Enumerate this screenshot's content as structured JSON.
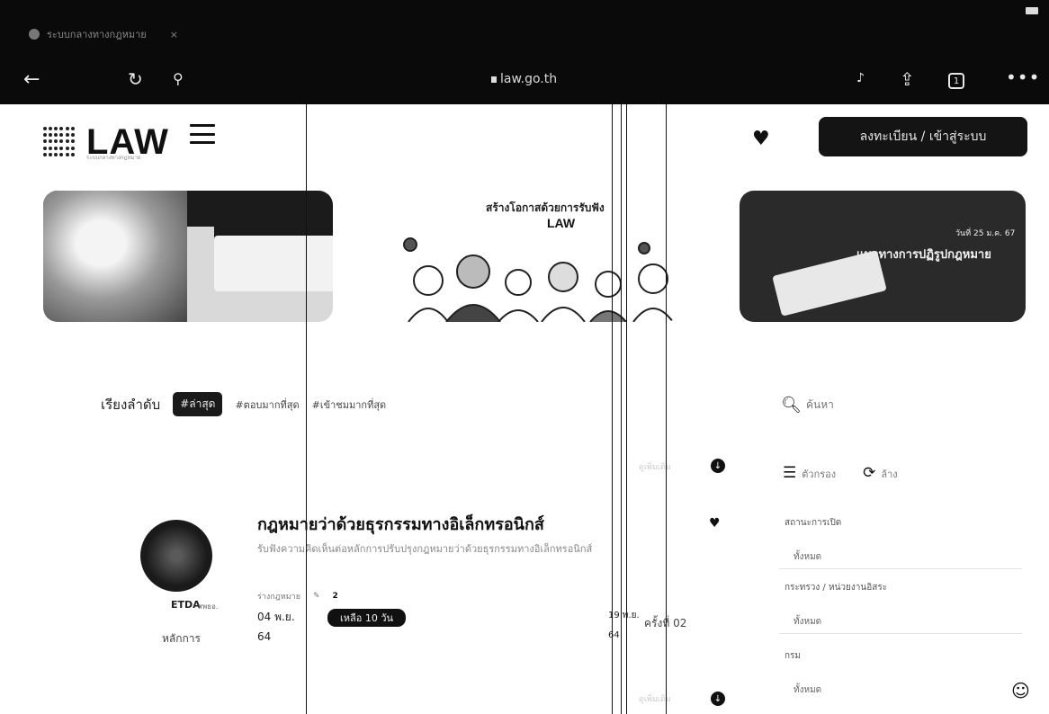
{
  "browser": {
    "tab_title": "ระบบกลางทางกฎหมาย",
    "tab_close": "×",
    "url": "law.go.th",
    "tab_count": "1",
    "icons": [
      "back-icon",
      "reload-icon",
      "translate-icon",
      "mic-icon",
      "share-icon",
      "tabs-icon",
      "more-icon"
    ]
  },
  "header": {
    "brand": "LAW",
    "tagline": "ระบบกลางทางกฎหมาย",
    "login_label": "ลงทะเบียน / เข้าสู่ระบบ"
  },
  "banners": [
    {
      "text": ""
    },
    {
      "title": "สร้างโอกาสด้วยการรับฟัง",
      "logo_text": "LAW"
    },
    {
      "badge": "วันที่ 25 ม.ค. 67",
      "title": "แนวทางการปฏิรูปกฎหมาย"
    }
  ],
  "sort": {
    "label": "เรียงลำดับ",
    "options": [
      "#ล่าสุด",
      "#ตอบมากที่สุด",
      "#เข้าชมมากที่สุด"
    ],
    "active_index": 0
  },
  "sidebar": {
    "search_placeholder": "ค้นหา",
    "filter_label": "ตัวกรอง",
    "clear_label": "ล้าง",
    "groups": [
      {
        "label": "สถานะการเปิด",
        "value": "ทั้งหมด"
      },
      {
        "label": "กระทรวง / หน่วยงานอิสระ",
        "value": "ทั้งหมด"
      },
      {
        "label": "กรม",
        "value": "ทั้งหมด"
      }
    ]
  },
  "card": {
    "title": "กฎหมายว่าด้วยธุรกรรมทางอิเล็กทรอนิกส์",
    "description": "รับฟังความคิดเห็นต่อหลักการปรับปรุงกฎหมายว่าด้วยธุรกรรมทางอิเล็กทรอนิกส์",
    "org_logo": "ETDA",
    "org_name": "สพธอ.",
    "principles_label": "หลักการ",
    "meta_label": "ร่างกฎหมาย",
    "meta_count": "2",
    "date_open": "04 พ.ย.",
    "deadline": "เหลือ 10 วัน",
    "count_open": "64",
    "date_close": "19 พ.ย.",
    "count_close": "64",
    "times_label": "ครั้งที่",
    "times_value": "02"
  },
  "list_hint": "ดูเพิ่มเติม"
}
